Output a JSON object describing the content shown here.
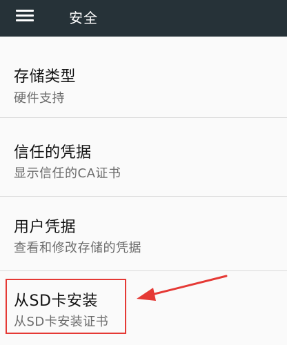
{
  "toolbar": {
    "title": "安全",
    "menu_icon": "hamburger-menu-icon"
  },
  "list": {
    "items": [
      {
        "title": "存储类型",
        "subtitle": "硬件支持"
      },
      {
        "title": "信任的凭据",
        "subtitle": "显示信任的CA证书"
      },
      {
        "title": "用户凭据",
        "subtitle": "查看和修改存储的凭据"
      },
      {
        "title": "从SD卡安装",
        "subtitle": "从SD卡安装证书"
      }
    ]
  },
  "annotation": {
    "highlight_color": "#e53935",
    "arrow_color": "#e53935"
  },
  "colors": {
    "toolbar_bg": "#263238",
    "page_bg": "#fafafa",
    "primary_text": "#111111",
    "secondary_text": "#6b6b6b",
    "divider": "#d9d9d9"
  }
}
